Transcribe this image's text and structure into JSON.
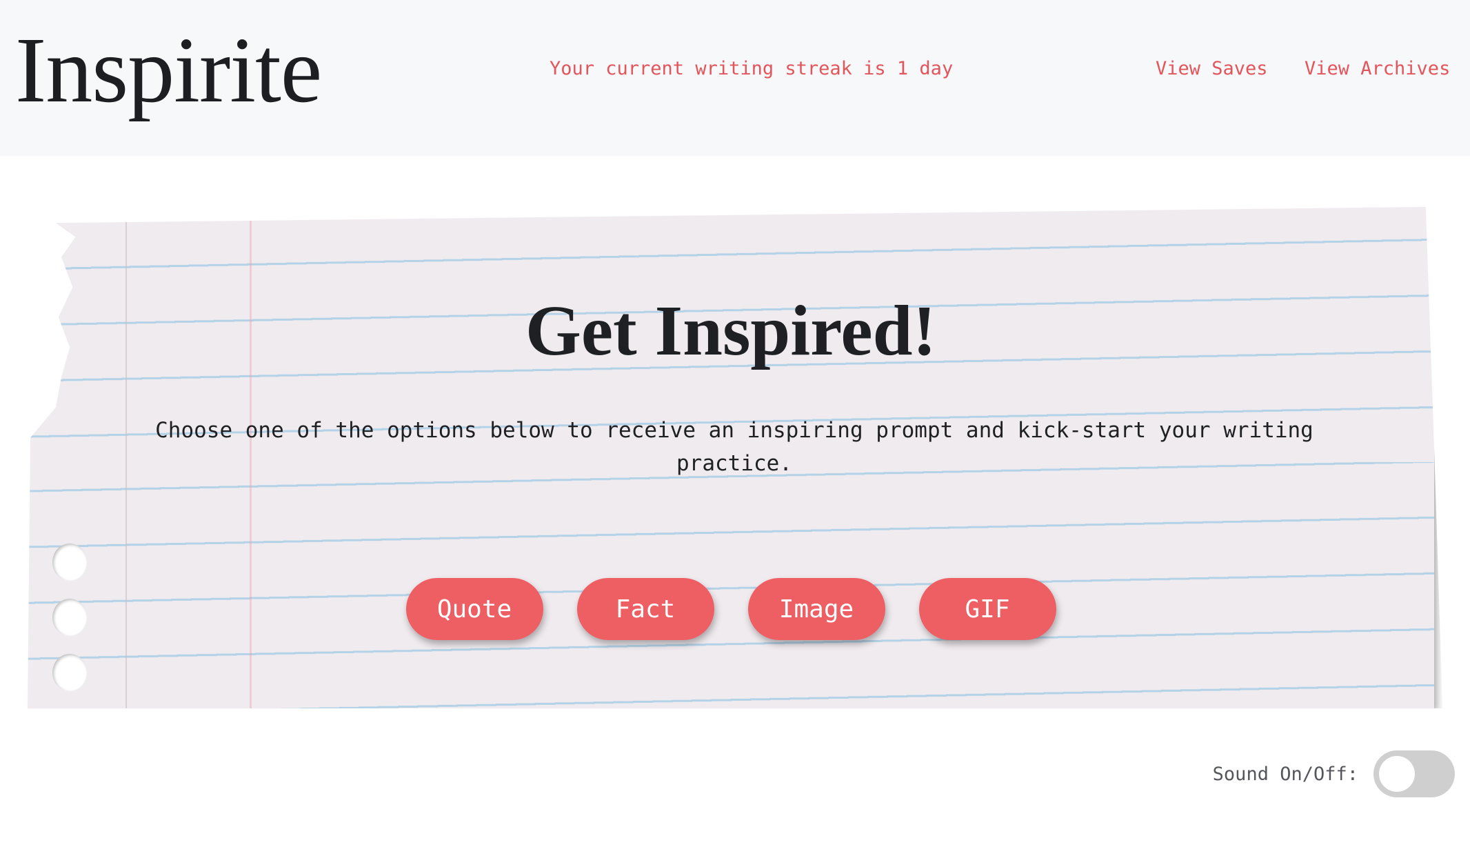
{
  "header": {
    "logo": "Inspirite",
    "streak_text": "Your current writing streak is 1 day",
    "nav": [
      {
        "label": "View Saves"
      },
      {
        "label": "View Archives"
      }
    ]
  },
  "main": {
    "title": "Get Inspired!",
    "subtitle": "Choose one of the options below to receive an inspiring prompt and kick-start your writing practice.",
    "buttons": [
      {
        "label": "Quote"
      },
      {
        "label": "Fact"
      },
      {
        "label": "Image"
      },
      {
        "label": "GIF"
      }
    ]
  },
  "sound": {
    "label": "Sound On/Off:",
    "enabled": false
  },
  "colors": {
    "accent": "#ee5f64",
    "link": "#e2555b",
    "header_bg": "#f7f8fa",
    "paper": "#f0ebef",
    "toggle_off": "#cfcfcf"
  }
}
